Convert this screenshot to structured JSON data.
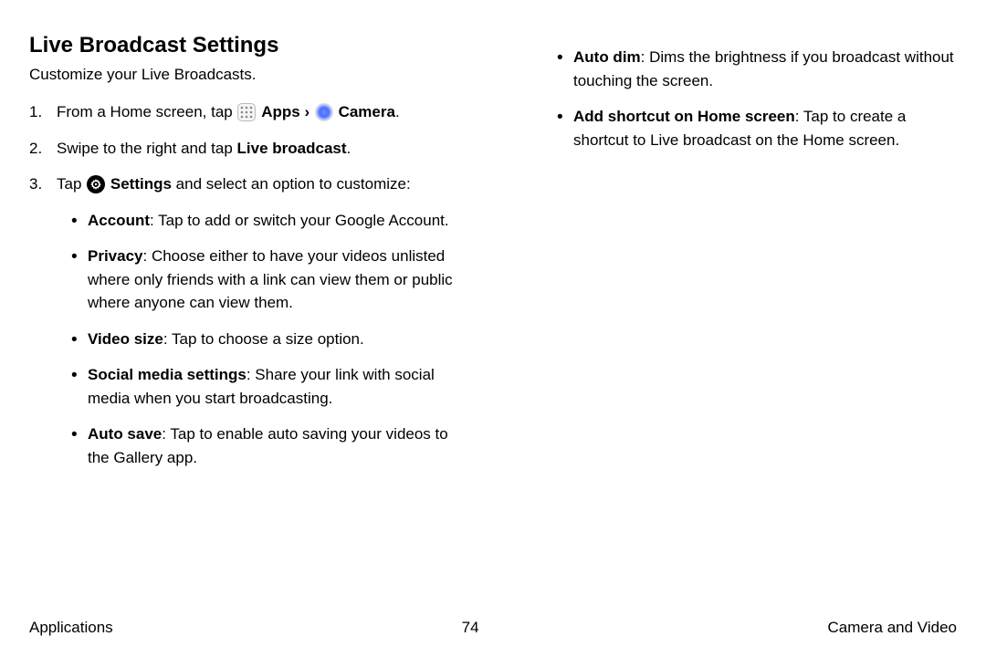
{
  "title": "Live Broadcast Settings",
  "subtitle": "Customize your Live Broadcasts.",
  "steps": {
    "s1_a": "From a Home screen, tap ",
    "s1_apps": "Apps",
    "s1_chev": "›",
    "s1_camera": "Camera",
    "s1_end": ".",
    "s2_a": "Swipe to the right and tap ",
    "s2_b": "Live broadcast",
    "s2_c": ".",
    "s3_a": "Tap ",
    "s3_b": "Settings",
    "s3_c": " and select an option to customize:"
  },
  "options_left": {
    "account_t": "Account",
    "account_d": ": Tap to add or switch your Google Account.",
    "privacy_t": "Privacy",
    "privacy_d": ": Choose either to have your videos unlisted where only friends with a link can view them or public where anyone can view them.",
    "video_t": "Video size",
    "video_d": ": Tap to choose a size option.",
    "social_t": "Social media settings",
    "social_d": ": Share your link with social media when you start broadcasting.",
    "autosave_t": "Auto save",
    "autosave_d": ": Tap to enable auto saving your videos to the Gallery app."
  },
  "options_right": {
    "autodim_t": "Auto dim",
    "autodim_d": ": Dims the brightness if you broadcast without touching the screen.",
    "shortcut_t": "Add shortcut on Home screen",
    "shortcut_d": ": Tap to create a shortcut to Live broadcast on the Home screen."
  },
  "footer": {
    "left": "Applications",
    "page": "74",
    "right": "Camera and Video"
  }
}
